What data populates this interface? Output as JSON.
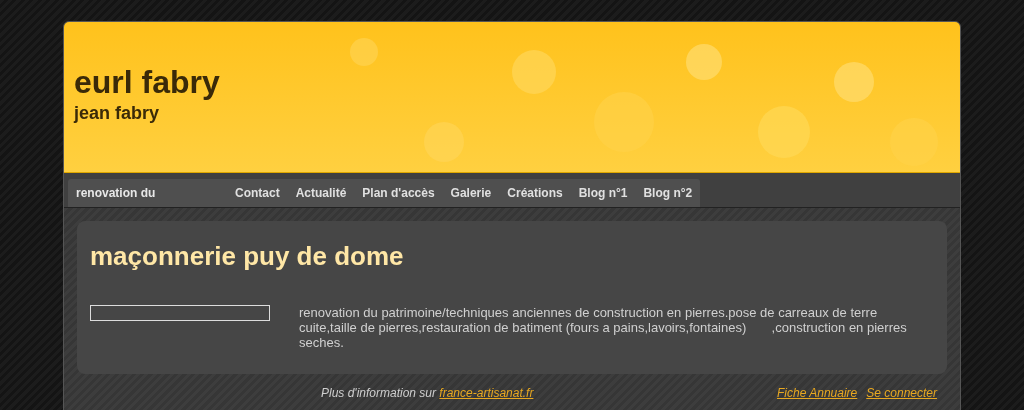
{
  "header": {
    "title": "eurl fabry",
    "subtitle": "jean fabry"
  },
  "nav": {
    "label": "renovation du",
    "items": [
      {
        "label": "Contact",
        "selected": false
      },
      {
        "label": "Actualité",
        "selected": false
      },
      {
        "label": "Plan d'accès",
        "selected": false
      },
      {
        "label": "Galerie",
        "selected": false
      },
      {
        "label": "Créations",
        "selected": false
      },
      {
        "label": "Blog n°1",
        "selected": false
      },
      {
        "label": "Blog n°2",
        "selected": false
      }
    ]
  },
  "content": {
    "heading": "maçonnerie puy de dome",
    "text": "renovation du patrimoine/techniques anciennes de construction en pierres.pose de carreaux de terre cuite,taille de pierres,restauration de batiment (fours a pains,lavoirs,fontaines)       ,construction en pierres seches."
  },
  "footer": {
    "info": "Plus d'information sur",
    "info_link": "france-artisanat.fr",
    "links": [
      "Fiche Annuaire",
      "Se connecter"
    ]
  }
}
